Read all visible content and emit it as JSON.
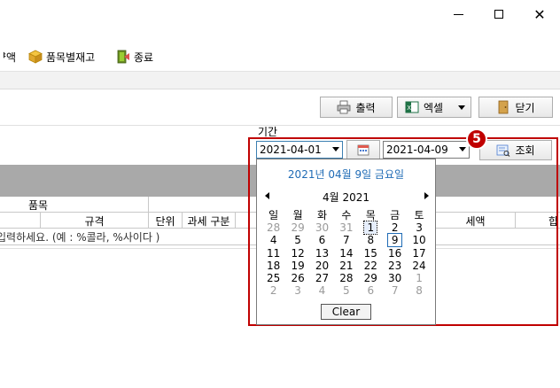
{
  "titlebar": {
    "minimize_label": "",
    "maximize_label": "",
    "close_label": "✕"
  },
  "toolbar": {
    "items": [
      {
        "label": "ᅣ액",
        "icon": "document-icon"
      },
      {
        "label": "품목별재고",
        "icon": "box-icon"
      },
      {
        "label": "종료",
        "icon": "exit-icon"
      }
    ]
  },
  "actions": {
    "print_label": "출력",
    "excel_label": "엑셀",
    "close_label": "닫기"
  },
  "filter": {
    "period_label": "기간",
    "start_date": "2021-04-01",
    "end_date": "2021-04-09",
    "search_label": "조회"
  },
  "grid": {
    "header_top": [
      "품목"
    ],
    "columns": [
      "규격",
      "단위",
      "과세 구분",
      "세액",
      "합"
    ],
    "filter_hint": "입력하세요. (예 : %콜라, %사이다 )"
  },
  "callout": {
    "number": "5",
    "color": "#c00000"
  },
  "calendar": {
    "today_text": "2021년 04월 9일 금요일",
    "month_label": "4월 2021",
    "weekdays": [
      "일",
      "월",
      "화",
      "수",
      "목",
      "금",
      "토"
    ],
    "weeks": [
      [
        {
          "d": "28",
          "o": true
        },
        {
          "d": "29",
          "o": true
        },
        {
          "d": "30",
          "o": true
        },
        {
          "d": "31",
          "o": true
        },
        {
          "d": "1",
          "o": false
        },
        {
          "d": "2",
          "o": false
        },
        {
          "d": "3",
          "o": false
        }
      ],
      [
        {
          "d": "4",
          "o": false
        },
        {
          "d": "5",
          "o": false
        },
        {
          "d": "6",
          "o": false
        },
        {
          "d": "7",
          "o": false
        },
        {
          "d": "8",
          "o": false
        },
        {
          "d": "9",
          "o": false
        },
        {
          "d": "10",
          "o": false
        }
      ],
      [
        {
          "d": "11",
          "o": false
        },
        {
          "d": "12",
          "o": false
        },
        {
          "d": "13",
          "o": false
        },
        {
          "d": "14",
          "o": false
        },
        {
          "d": "15",
          "o": false
        },
        {
          "d": "16",
          "o": false
        },
        {
          "d": "17",
          "o": false
        }
      ],
      [
        {
          "d": "18",
          "o": false
        },
        {
          "d": "19",
          "o": false
        },
        {
          "d": "20",
          "o": false
        },
        {
          "d": "21",
          "o": false
        },
        {
          "d": "22",
          "o": false
        },
        {
          "d": "23",
          "o": false
        },
        {
          "d": "24",
          "o": false
        }
      ],
      [
        {
          "d": "25",
          "o": false
        },
        {
          "d": "26",
          "o": false
        },
        {
          "d": "27",
          "o": false
        },
        {
          "d": "28",
          "o": false
        },
        {
          "d": "29",
          "o": false
        },
        {
          "d": "30",
          "o": false
        },
        {
          "d": "1",
          "o": true
        }
      ],
      [
        {
          "d": "2",
          "o": true
        },
        {
          "d": "3",
          "o": true
        },
        {
          "d": "4",
          "o": true
        },
        {
          "d": "5",
          "o": true
        },
        {
          "d": "6",
          "o": true
        },
        {
          "d": "7",
          "o": true
        },
        {
          "d": "8",
          "o": true
        }
      ]
    ],
    "focused_day": "1",
    "selected_day": "9",
    "clear_label": "Clear",
    "accent_color": "#1f6bb5"
  }
}
